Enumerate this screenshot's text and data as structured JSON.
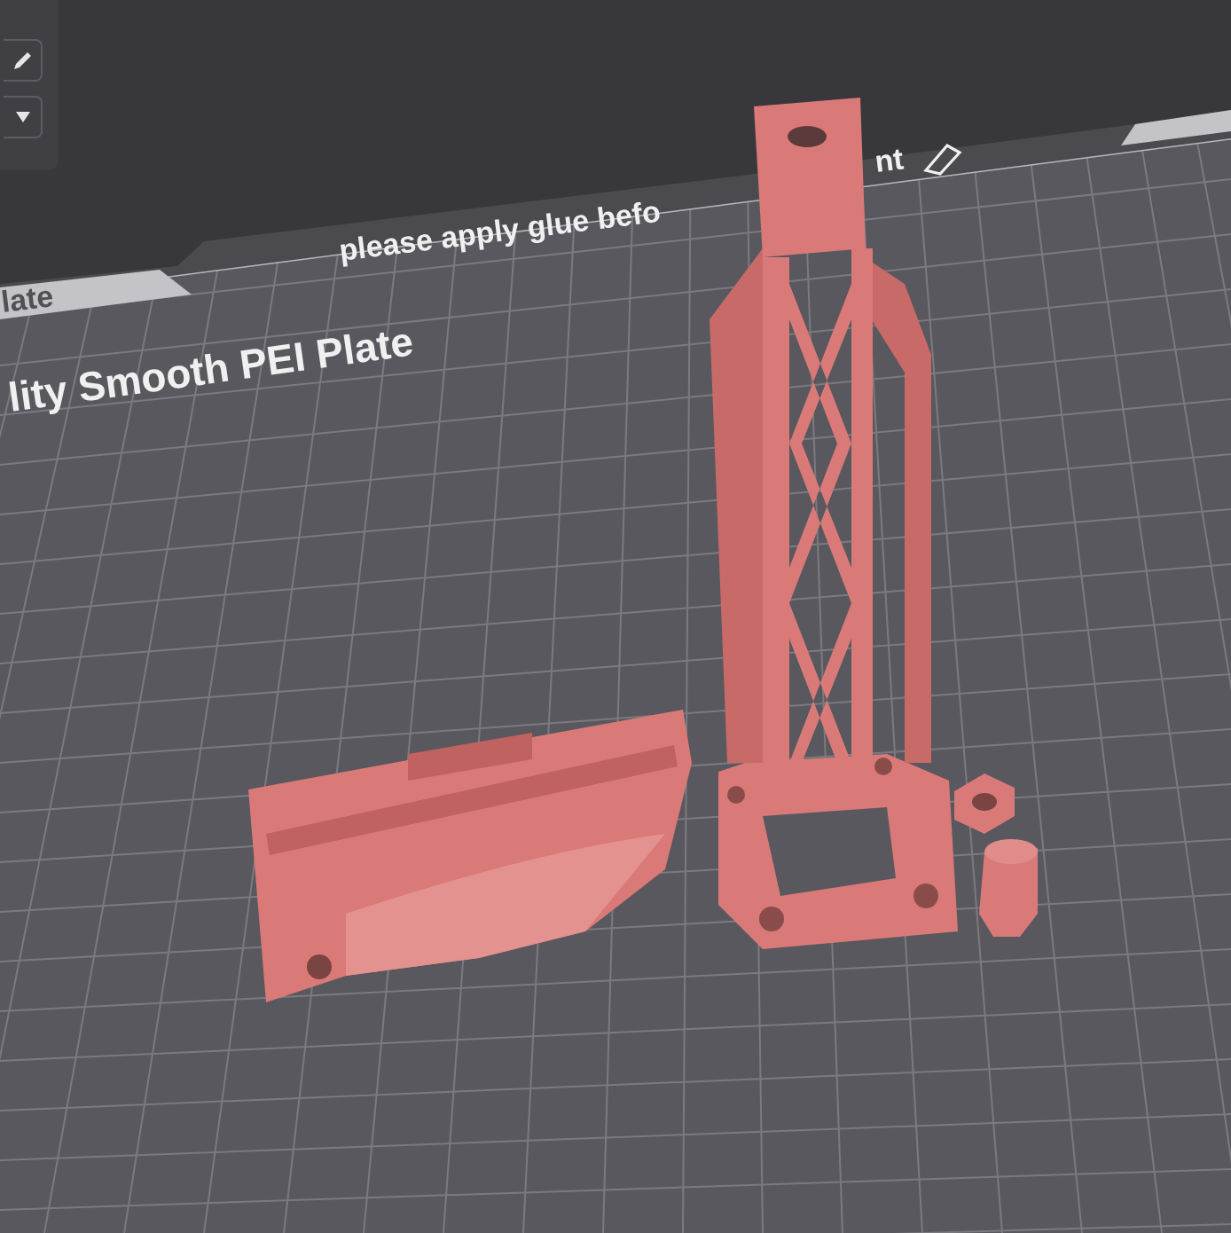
{
  "toolbar": {
    "buttons": [
      {
        "kind": "edit"
      },
      {
        "kind": "dropdown"
      }
    ]
  },
  "plate": {
    "notes": [
      "please apply glue befo",
      "nt"
    ],
    "tab_label": "late",
    "plate_type": "lity Smooth PEI Plate"
  }
}
